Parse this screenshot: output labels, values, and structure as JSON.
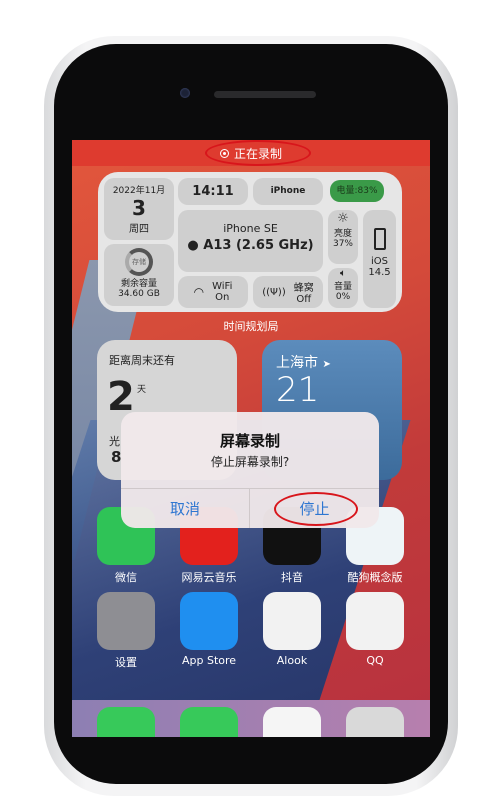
{
  "status_bar": {
    "recording_label": "正在录制"
  },
  "info_widget": {
    "date_year_month": "2022年11月",
    "date_day": "3",
    "weekday": "周四",
    "storage_ring_label": "存储",
    "storage_label": "剩余容量",
    "storage_value": "34.60 GB",
    "time": "14:11",
    "device_label": "iPhone",
    "battery": "电量:83%",
    "model": "iPhone SE",
    "chip": "A13 (2.65 GHz)",
    "brightness_label": "亮度",
    "brightness_value": "37%",
    "volume_label": "音量",
    "volume_value": "0%",
    "os_name": "iOS",
    "os_version": "14.5",
    "wifi_label": "WiFi",
    "wifi_value": "On",
    "cellular_label": "蜂窝",
    "cellular_value": "Off",
    "widget_name": "时间规划局",
    "colors": {
      "battery": "#3a9a48"
    }
  },
  "weekend_widget": {
    "title": "距离周末还有",
    "days": "2",
    "unit": "天",
    "partial_label": "光",
    "partial_value": "8"
  },
  "weather_widget": {
    "city": "上海市",
    "temperature": "21"
  },
  "alert": {
    "title": "屏幕录制",
    "message": "停止屏幕录制?",
    "cancel": "取消",
    "stop": "停止"
  },
  "apps": [
    {
      "label": "微信",
      "icon": "wechat-icon",
      "color": "#2fc357"
    },
    {
      "label": "网易云音乐",
      "icon": "netease-music-icon",
      "color": "#e3211d"
    },
    {
      "label": "抖音",
      "icon": "douyin-icon",
      "color": "#111111"
    },
    {
      "label": "酷狗概念版",
      "icon": "kugou-icon",
      "color": "#eef4f7"
    },
    {
      "label": "设置",
      "icon": "settings-gear-icon",
      "color": "#8e8e93"
    },
    {
      "label": "App Store",
      "icon": "app-store-icon",
      "color": "#1f8ff0"
    },
    {
      "label": "Alook",
      "icon": "alook-icon",
      "color": "#f2f2f2"
    },
    {
      "label": "QQ",
      "icon": "qq-penguin-icon",
      "color": "#f2f2f2"
    }
  ],
  "dock": [
    {
      "icon": "phone-icon",
      "color": "#37c95a"
    },
    {
      "icon": "messages-icon",
      "color": "#37c95a"
    },
    {
      "icon": "photos-icon",
      "color": "#f5f5f5"
    },
    {
      "icon": "camera-icon",
      "color": "#d9d9d9"
    }
  ]
}
